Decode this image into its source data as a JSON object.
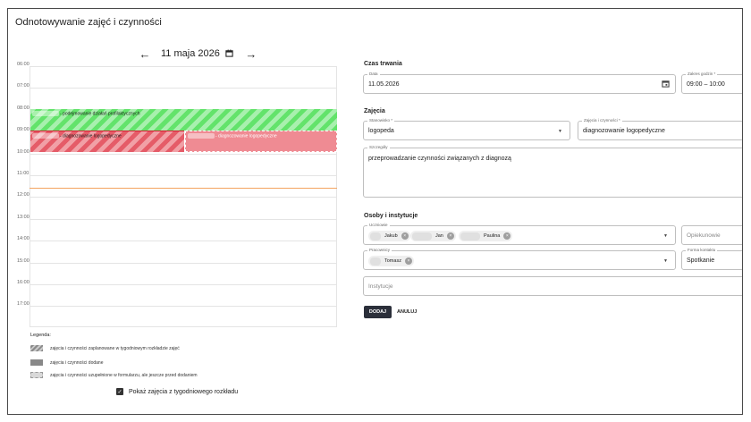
{
  "page": {
    "title": "Odnotowywanie zajęć i czynności"
  },
  "datenav": {
    "prev": "←",
    "date": "11 maja 2026",
    "next": "→"
  },
  "calendar": {
    "hours": [
      "06:00",
      "07:00",
      "08:00",
      "09:00",
      "10:00",
      "11:00",
      "12:00",
      "13:00",
      "14:00",
      "15:00",
      "16:00",
      "17:00"
    ],
    "events": {
      "green_label": "- podejmowanie działań profilaktycznych",
      "red_label": "- diagnozowanie logopedyczne",
      "pink_label": "- diagnozowanie logopedyczne"
    }
  },
  "legend": {
    "title": "Legenda:",
    "items": [
      "zajęcia i czynności zaplanowane w tygodniowym rozkładzie zajęć",
      "zajęcia i czynności dodane",
      "zajęcia i czynności uzupełnione w formularzu, ale jeszcze przed dodaniem"
    ]
  },
  "show_weekly": {
    "label": "Pokaż zajęcia z tygodniowego rozkładu",
    "checked": true
  },
  "form": {
    "czas": {
      "section": "Czas trwania",
      "data_label": "Data",
      "data_value": "11.05.2026",
      "zakres_label": "Zakres godzin *",
      "zakres_value": "09:00 – 10:00"
    },
    "zajecia": {
      "section": "Zajęcia",
      "stanowisko_label": "Stanowisko *",
      "stanowisko_value": "logopeda",
      "zajecia_label": "Zajęcia i czynności *",
      "zajecia_value": "diagnozowanie logopedyczne",
      "szczegoly_label": "Szczegóły",
      "szczegoly_value": "przeprowadzanie czynności związanych z diagnozą"
    },
    "osoby": {
      "section": "Osoby i instytucje",
      "uczniowie_label": "Uczniowie",
      "uczniowie": [
        "Jakub",
        "Jan",
        "Paulina"
      ],
      "opiekunowie_placeholder": "Opiekunowie",
      "pracownicy_label": "Pracownicy",
      "pracownicy": [
        "Tomasz"
      ],
      "forma_label": "Forma kontaktu",
      "forma_value": "Spotkanie",
      "instytucje_placeholder": "Instytucje"
    },
    "buttons": {
      "dodaj": "DODAJ",
      "anuluj": "ANULUJ"
    }
  }
}
